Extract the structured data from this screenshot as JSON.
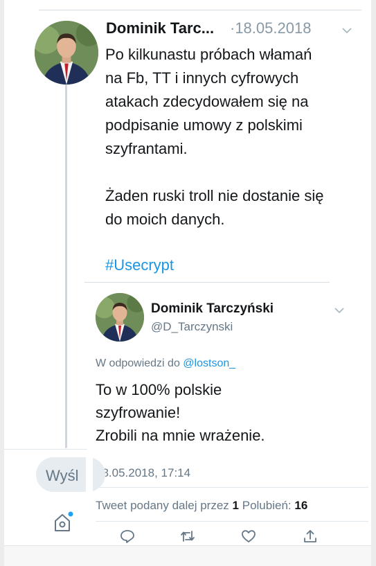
{
  "colors": {
    "text": "#14171a",
    "muted": "#657786",
    "link": "#1b95e0",
    "divider": "#e1e8ed",
    "notification_dot": "#1da1f2"
  },
  "tweet": {
    "author_name": "Dominik Tarc...",
    "date": "·18.05.2018",
    "text": "Po kilkunastu próbach włamań\nna Fb, TT i innych cyfrowych\natakach zdecydowałem się na\npodpisanie umowy z polskimi\nszyfrantami.\n\nŻaden ruski troll nie dostanie się\ndo moich danych.",
    "hashtag": "#Usecrypt",
    "menu_icon": "chevron-down-icon"
  },
  "quoted_tweet": {
    "author_name": "Dominik Tarczyński",
    "handle": "@D_Tarczynski",
    "reply_prefix": "W odpowiedzi do",
    "reply_mention": "@lostson_",
    "text": "To w 100% polskie\nszyfrowanie!\nZrobili na mnie wrażenie.",
    "timestamp": "18.05.2018, 17:14",
    "retweets_label": "Tweet podany dalej przez",
    "retweets_count": "1",
    "likes_label": "Polubień:",
    "likes_count": "16",
    "menu_icon": "chevron-down-icon"
  },
  "actions": [
    {
      "icon": "reply-icon"
    },
    {
      "icon": "retweet-icon"
    },
    {
      "icon": "like-icon"
    },
    {
      "icon": "share-icon"
    }
  ],
  "composer": {
    "placeholder": "Wyśl"
  },
  "nav": {
    "home_icon": "home-icon"
  }
}
